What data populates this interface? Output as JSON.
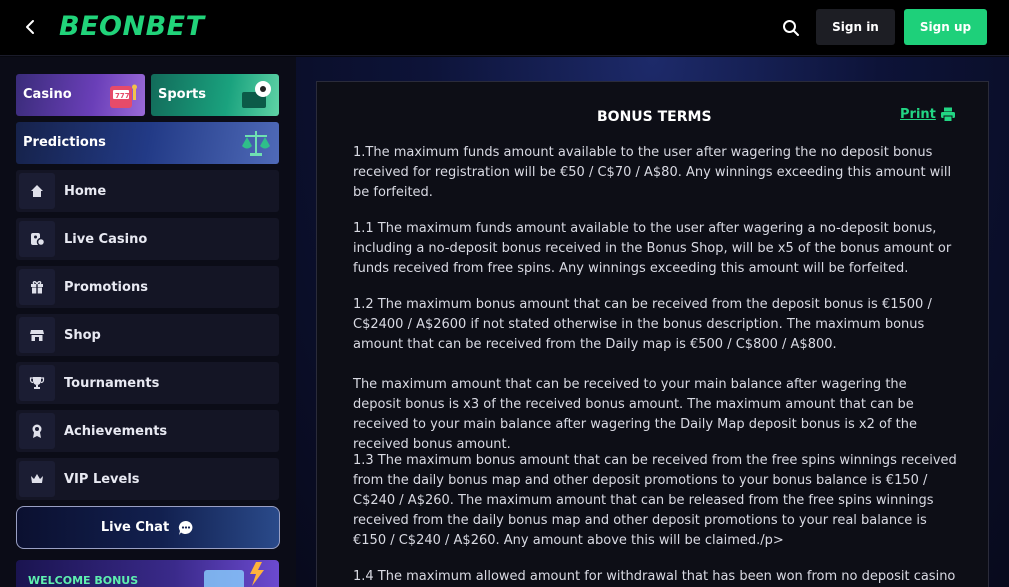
{
  "header": {
    "logo": "BEONBET",
    "signin_label": "Sign in",
    "signup_label": "Sign up",
    "accent": "#1ed07a"
  },
  "sidebar": {
    "tiles": [
      {
        "label": "Casino"
      },
      {
        "label": "Sports"
      },
      {
        "label": "Predictions"
      }
    ],
    "items": [
      {
        "label": "Home",
        "icon": "home-icon"
      },
      {
        "label": "Live Casino",
        "icon": "live-casino-icon"
      },
      {
        "label": "Promotions",
        "icon": "gift-icon"
      },
      {
        "label": "Shop",
        "icon": "shop-icon"
      },
      {
        "label": "Tournaments",
        "icon": "trophy-icon"
      },
      {
        "label": "Achievements",
        "icon": "medal-icon"
      },
      {
        "label": "VIP Levels",
        "icon": "crown-icon"
      }
    ],
    "live_chat": "Live Chat",
    "welcome_bonus": "WELCOME BONUS"
  },
  "terms": {
    "title": "BONUS TERMS",
    "print_label": "Print",
    "paragraphs": [
      "1.The maximum funds amount available to the user after wagering the no deposit bonus received for registration will be €50 / C$70 / A$80. Any winnings exceeding this amount will be forfeited.",
      "1.1 The maximum funds amount available to the user after wagering a no-deposit bonus, including a no-deposit bonus received in the Bonus Shop, will be x5 of the bonus amount or funds received from free spins. Any winnings exceeding this amount will be forfeited.",
      "1.2 The maximum bonus amount that can be received from the deposit bonus is €1500 / C$2400 / A$2600 if not stated otherwise in the bonus description. The maximum bonus amount that can be received from the Daily map is €500 / C$800 / A$800.",
      "The maximum amount that can be received to your main balance after wagering the deposit bonus is x3 of the received bonus amount. The maximum amount that can be received to your main balance after wagering the Daily Map deposit bonus is x2 of the received bonus amount.",
      "1.3 The maximum bonus amount that can be received from the free spins winnings received from the daily bonus map and other deposit promotions to your bonus balance is €150 / C$240 / A$260. The maximum amount that can be released from the free spins winnings received from the daily bonus map and other deposit promotions to your real balance is €150 / C$240 / A$260. Any amount above this will be claimed./p>",
      "1.4 The maximum allowed amount for withdrawal that has been won from no deposit casino"
    ]
  }
}
